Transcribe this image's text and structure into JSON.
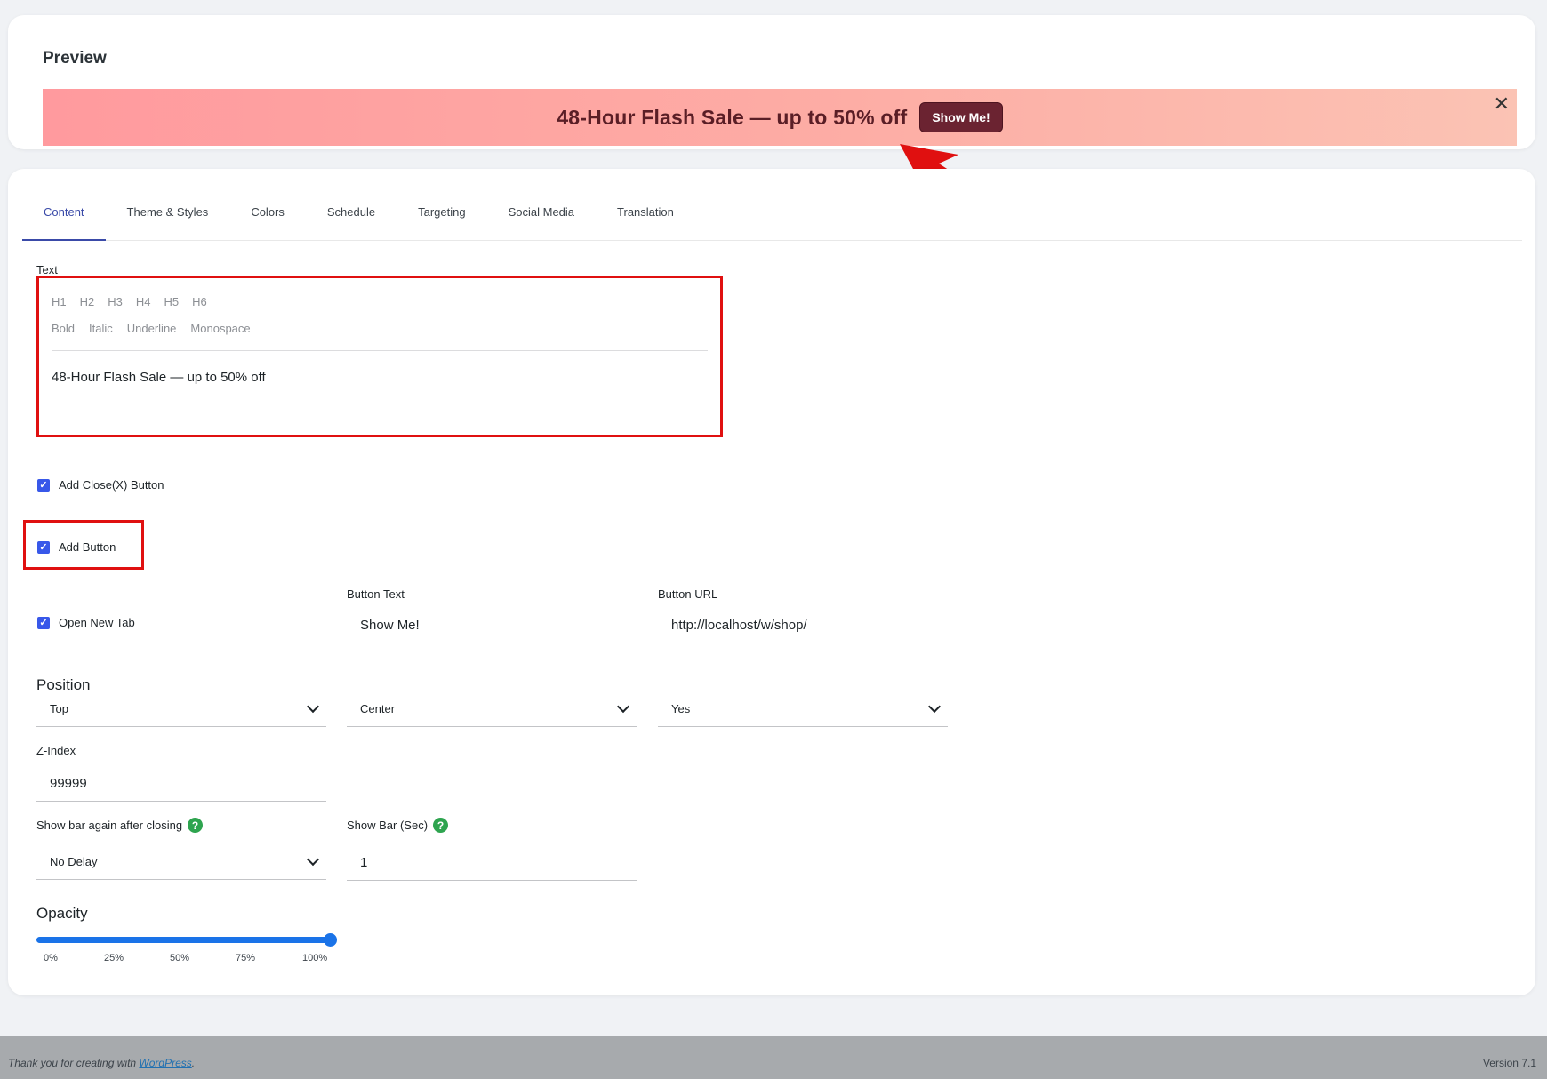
{
  "preview": {
    "title": "Preview",
    "bar_text": "48-Hour Flash Sale — up to 50% off",
    "button_text": "Show Me!",
    "close_glyph": "✕"
  },
  "tabs": [
    "Content",
    "Theme & Styles",
    "Colors",
    "Schedule",
    "Targeting",
    "Social Media",
    "Translation"
  ],
  "editor": {
    "label": "Text",
    "headings": [
      "H1",
      "H2",
      "H3",
      "H4",
      "H5",
      "H6"
    ],
    "formats": [
      "Bold",
      "Italic",
      "Underline",
      "Monospace"
    ],
    "content": "48-Hour Flash Sale — up to 50% off"
  },
  "checkboxes": {
    "close_button": "Add Close(X) Button",
    "add_button": "Add Button",
    "open_new_tab": "Open New Tab"
  },
  "button_text": {
    "label": "Button Text",
    "value": "Show Me!"
  },
  "button_url": {
    "label": "Button URL",
    "value": "http://localhost/w/shop/"
  },
  "position": {
    "label": "Position",
    "vertical": "Top",
    "horizontal": "Center",
    "sticky": "Yes"
  },
  "z_index": {
    "label": "Z-Index",
    "value": "99999"
  },
  "show_again": {
    "label": "Show bar again after closing",
    "value": "No Delay"
  },
  "show_bar": {
    "label": "Show Bar (Sec)",
    "value": "1"
  },
  "opacity": {
    "label": "Opacity",
    "value_percent": 100,
    "ticks": [
      "0%",
      "25%",
      "50%",
      "75%",
      "100%"
    ]
  },
  "footer": {
    "text_prefix": "Thank you for creating with ",
    "link": "WordPress",
    "text_suffix": ".",
    "version": "Version 7.1"
  },
  "colors": {
    "accent": "#3858e9",
    "highlight": "#e01010",
    "bar_button": "#6b2331"
  }
}
